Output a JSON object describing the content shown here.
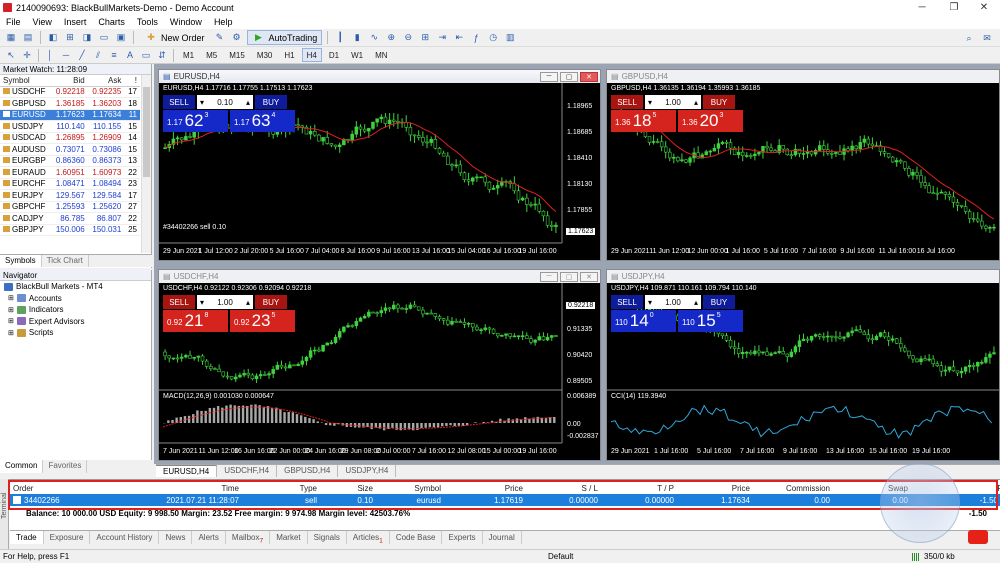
{
  "window": {
    "title": "2140090693: BlackBullMarkets-Demo - Demo Account"
  },
  "menu": [
    "File",
    "View",
    "Insert",
    "Charts",
    "Tools",
    "Window",
    "Help"
  ],
  "toolbar": {
    "new_order": "New Order",
    "autotrading": "AutoTrading"
  },
  "timeframes": [
    "M1",
    "M5",
    "M15",
    "M30",
    "H1",
    "H4",
    "D1",
    "W1",
    "MN"
  ],
  "active_timeframe": "H4",
  "market_watch": {
    "title": "Market Watch: 11:28:09",
    "headers": [
      "Symbol",
      "Bid",
      "Ask",
      "!"
    ],
    "rows": [
      {
        "symbol": "USDCHF",
        "bid": "0.92218",
        "ask": "0.92235",
        "spread": "17",
        "color": "red"
      },
      {
        "symbol": "GBPUSD",
        "bid": "1.36185",
        "ask": "1.36203",
        "spread": "18",
        "color": "red"
      },
      {
        "symbol": "EURUSD",
        "bid": "1.17623",
        "ask": "1.17634",
        "spread": "11",
        "color": "sel"
      },
      {
        "symbol": "USDJPY",
        "bid": "110.140",
        "ask": "110.155",
        "spread": "15",
        "color": "blue"
      },
      {
        "symbol": "USDCAD",
        "bid": "1.26895",
        "ask": "1.26909",
        "spread": "14",
        "color": "red"
      },
      {
        "symbol": "AUDUSD",
        "bid": "0.73071",
        "ask": "0.73086",
        "spread": "15",
        "color": "blue"
      },
      {
        "symbol": "EURGBP",
        "bid": "0.86360",
        "ask": "0.86373",
        "spread": "13",
        "color": "blue"
      },
      {
        "symbol": "EURAUD",
        "bid": "1.60951",
        "ask": "1.60973",
        "spread": "22",
        "color": "red"
      },
      {
        "symbol": "EURCHF",
        "bid": "1.08471",
        "ask": "1.08494",
        "spread": "23",
        "color": "blue"
      },
      {
        "symbol": "EURJPY",
        "bid": "129.567",
        "ask": "129.584",
        "spread": "17",
        "color": "blue"
      },
      {
        "symbol": "GBPCHF",
        "bid": "1.25593",
        "ask": "1.25620",
        "spread": "27",
        "color": "blue"
      },
      {
        "symbol": "CADJPY",
        "bid": "86.785",
        "ask": "86.807",
        "spread": "22",
        "color": "blue"
      },
      {
        "symbol": "GBPJPY",
        "bid": "150.006",
        "ask": "150.031",
        "spread": "25",
        "color": "blue"
      }
    ],
    "tabs": [
      "Symbols",
      "Tick Chart"
    ]
  },
  "navigator": {
    "title": "Navigator",
    "items": [
      "BlackBull Markets - MT4",
      "Accounts",
      "Indicators",
      "Expert Advisors",
      "Scripts"
    ],
    "tabs": [
      "Common",
      "Favorites"
    ]
  },
  "charts": {
    "eurusd": {
      "title": "EURUSD,H4",
      "ohlc": "EURUSD,H4  1.17716 1.17755 1.17513 1.17623",
      "lot": "0.10",
      "sell_small": "1.17",
      "sell_big": "62",
      "sell_sup": "3",
      "buy_small": "1.17",
      "buy_big": "63",
      "buy_sup": "4",
      "sell": "SELL",
      "buy": "BUY",
      "yticks": [
        "1.18965",
        "1.18685",
        "1.18410",
        "1.18130",
        "1.17855",
        "1.17623"
      ],
      "xticks": [
        "29 Jun 2021",
        "1 Jul 12:00",
        "2 Jul 20:00",
        "5 Jul 16:00",
        "7 Jul 04:00",
        "8 Jul 16:00",
        "9 Jul 16:00",
        "13 Jul 16:00",
        "15 Jul 04:00",
        "16 Jul 16:00",
        "19 Jul 16:00"
      ],
      "order_label": "#34402266 sell 0.10"
    },
    "gbpusd": {
      "title": "GBPUSD,H4",
      "ohlc": "GBPUSD,H4  1.36135 1.36194 1.35993 1.36185",
      "lot": "1.00",
      "sell_small": "1.36",
      "sell_big": "18",
      "sell_sup": "5",
      "buy_small": "1.36",
      "buy_big": "20",
      "buy_sup": "3",
      "sell": "SELL",
      "buy": "BUY",
      "xticks": [
        "29 Jun 2021",
        "11 Jun 12:00",
        "12 Jun 00:00",
        "1 Jul 16:00",
        "5 Jul 16:00",
        "7 Jul 16:00",
        "9 Jul 16:00",
        "11 Jul 16:00",
        "16 Jul 16:00"
      ]
    },
    "usdchf": {
      "title": "USDCHF,H4",
      "ohlc": "USDCHF,H4  0.92122 0.92306 0.92094 0.92218",
      "lot": "1.00",
      "sell_small": "0.92",
      "sell_big": "21",
      "sell_sup": "8",
      "buy_small": "0.92",
      "buy_big": "23",
      "buy_sup": "5",
      "sell": "SELL",
      "buy": "BUY",
      "yticks": [
        "0.92218",
        "0.91335",
        "0.90420",
        "0.89505"
      ],
      "macd_label": "MACD(12,26,9) 0.001030 0.000647",
      "macd_yticks": [
        "0.006389",
        "0.00",
        "-0.002837"
      ],
      "xticks": [
        "7 Jun 2021",
        "11 Jun 12:00",
        "16 Jun 16:00",
        "22 Jun 00:00",
        "24 Jun 16:00",
        "29 Jun 08:00",
        "2 Jul 00:00",
        "7 Jul 16:00",
        "12 Jul 08:00",
        "15 Jul 00:00",
        "19 Jul 16:00"
      ]
    },
    "usdjpy": {
      "title": "USDJPY,H4",
      "ohlc": "USDJPY,H4  109.871 110.161 109.794 110.140",
      "lot": "1.00",
      "sell_small": "110",
      "sell_big": "14",
      "sell_sup": "0",
      "buy_small": "110",
      "buy_big": "15",
      "buy_sup": "5",
      "sell": "SELL",
      "buy": "BUY",
      "cci_label": "CCI(14) 119.3940",
      "xticks": [
        "29 Jun 2021",
        "1 Jul 16:00",
        "5 Jul 16:00",
        "7 Jul 16:00",
        "9 Jul 16:00",
        "13 Jul 16:00",
        "15 Jul 16:00",
        "19 Jul 16:00"
      ]
    }
  },
  "chart_tabs": [
    "EURUSD,H4",
    "USDCHF,H4",
    "GBPUSD,H4",
    "USDJPY,H4"
  ],
  "terminal": {
    "side_label": "Terminal",
    "headers": [
      "Order",
      "Time",
      "Type",
      "Size",
      "Symbol",
      "Price",
      "S / L",
      "T / P",
      "Price",
      "Commission",
      "Swap",
      "Profit"
    ],
    "order": [
      "34402266",
      "2021.07.21 11:28:07",
      "sell",
      "0.10",
      "eurusd",
      "1.17619",
      "0.00000",
      "0.00000",
      "1.17634",
      "0.00",
      "0.00",
      "-1.50"
    ],
    "balance_line": "Balance: 10 000.00 USD  Equity: 9 998.50  Margin: 23.52  Free margin: 9 974.98  Margin level: 42503.76%",
    "balance_profit": "-1.50",
    "tabs": [
      "Trade",
      "Exposure",
      "Account History",
      "News",
      "Alerts",
      "Mailbox",
      "Market",
      "Signals",
      "Articles",
      "Code Base",
      "Experts",
      "Journal"
    ],
    "badges": {
      "Mailbox": "7",
      "Articles": "1"
    }
  },
  "status": {
    "help": "For Help, press F1",
    "profile": "Default",
    "traffic": "350/0 kb"
  }
}
